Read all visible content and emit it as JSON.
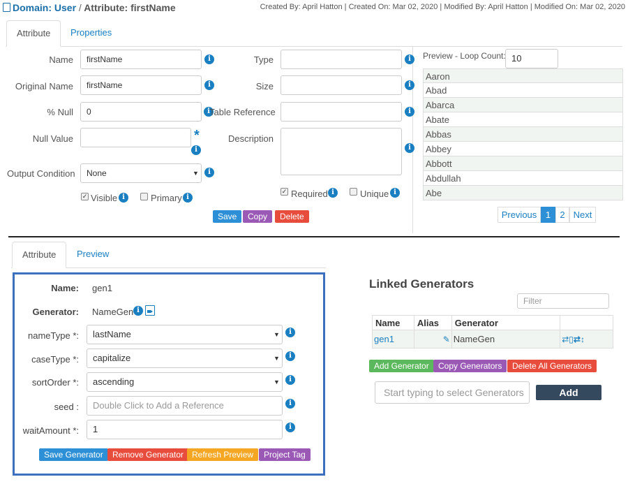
{
  "header": {
    "domain_label": "Domain: User",
    "separator": "/",
    "attribute_label": "Attribute: firstName",
    "meta": "Created By: April Hatton | Created On: Mar 02, 2020 | Modified By: April Hatton | Modified On: Mar 02, 2020"
  },
  "top_tabs": {
    "attribute": "Attribute",
    "properties": "Properties"
  },
  "form": {
    "name_label": "Name",
    "name_value": "firstName",
    "original_name_label": "Original Name",
    "original_name_value": "firstName",
    "null_pct_label": "% Null",
    "null_pct_value": "0",
    "null_value_label": "Null Value",
    "output_condition_label": "Output Condition",
    "output_condition_value": "None",
    "type_label": "Type",
    "size_label": "Size",
    "table_reference_label": "Table Reference",
    "description_label": "Description",
    "visible_label": "Visible",
    "primary_label": "Primary",
    "required_label": "Required",
    "unique_label": "Unique",
    "save": "Save",
    "copy": "Copy",
    "delete": "Delete"
  },
  "preview": {
    "loop_label": "Preview - Loop Count:",
    "loop_value": "10",
    "rows": [
      "Aaron",
      "Abad",
      "Abarca",
      "Abate",
      "Abbas",
      "Abbey",
      "Abbott",
      "Abdullah",
      "Abe"
    ],
    "prev": "Previous",
    "page1": "1",
    "page2": "2",
    "next": "Next"
  },
  "bottom_tabs": {
    "attribute": "Attribute",
    "preview": "Preview"
  },
  "generator": {
    "name_label": "Name:",
    "name_value": "gen1",
    "generator_label": "Generator:",
    "generator_value": "NameGen",
    "nametype_label": "nameType *:",
    "nametype_value": "lastName",
    "casetype_label": "caseType *:",
    "casetype_value": "capitalize",
    "sortorder_label": "sortOrder *:",
    "sortorder_value": "ascending",
    "seed_label": "seed :",
    "seed_placeholder": "Double Click to Add a Reference",
    "waitamount_label": "waitAmount *:",
    "waitamount_value": "1",
    "save": "Save Generator",
    "remove": "Remove Generator",
    "refresh": "Refresh Preview",
    "project_tag": "Project Tag"
  },
  "linked": {
    "title": "Linked Generators",
    "filter_placeholder": "Filter",
    "columns": [
      "Name",
      "Alias",
      "Generator"
    ],
    "row": {
      "name": "gen1",
      "alias": "",
      "generator": "NameGen"
    },
    "add_generator": "Add Generator",
    "copy_generators": "Copy Generators",
    "delete_all": "Delete All Generators",
    "select_placeholder": "Start typing to select Generators",
    "add": "Add"
  },
  "colors": {
    "link": "#1a7fc1",
    "save": "#2d8fd5",
    "copy": "#9b59b6",
    "delete": "#e74c3c",
    "add": "#5cb85c",
    "refresh": "#f5a623",
    "add_dark": "#34495e",
    "highlight": "#3d6fbf"
  }
}
